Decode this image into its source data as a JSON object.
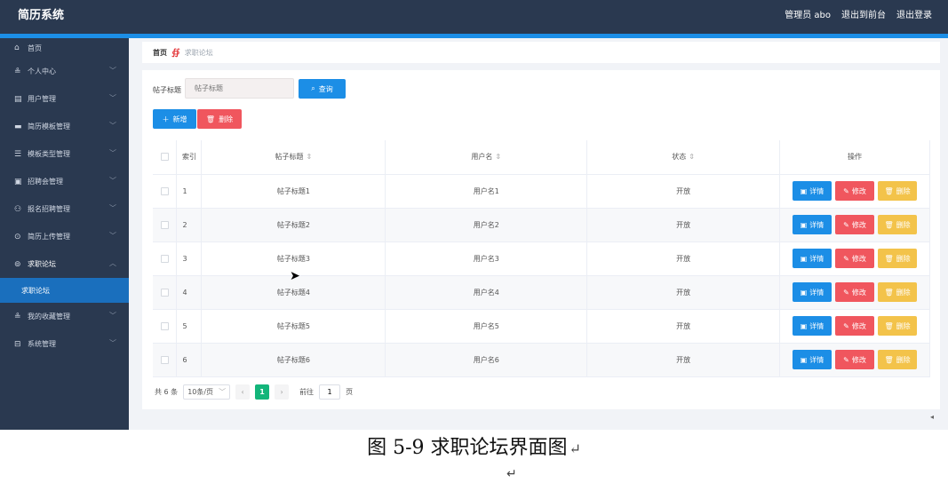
{
  "header": {
    "brand": "简历系统",
    "user": "管理员 abo",
    "to_front": "退出到前台",
    "logout": "退出登录"
  },
  "sidebar": {
    "items": [
      {
        "icon": "home-icon",
        "glyph": "⌂",
        "label": "首页"
      },
      {
        "icon": "user-icon",
        "glyph": "≗",
        "label": "个人中心"
      },
      {
        "icon": "users-icon",
        "glyph": "▤",
        "label": "用户管理"
      },
      {
        "icon": "template-icon",
        "glyph": "▬",
        "label": "简历模板管理"
      },
      {
        "icon": "category-icon",
        "glyph": "☰",
        "label": "模板类型管理"
      },
      {
        "icon": "job-fair-icon",
        "glyph": "▣",
        "label": "招聘会管理"
      },
      {
        "icon": "apply-icon",
        "glyph": "⚇",
        "label": "报名招聘管理"
      },
      {
        "icon": "upload-icon",
        "glyph": "⊙",
        "label": "简历上传管理"
      },
      {
        "icon": "forum-icon",
        "glyph": "⊚",
        "label": "求职论坛"
      },
      {
        "icon": "favorite-icon",
        "glyph": "≗",
        "label": "我的收藏管理"
      },
      {
        "icon": "system-icon",
        "glyph": "⊟",
        "label": "系统管理"
      }
    ],
    "active_sub": "求职论坛"
  },
  "breadcrumb": {
    "home": "首页",
    "separator": "∯",
    "current": "求职论坛"
  },
  "search": {
    "label": "帖子标题",
    "placeholder": "帖子标题",
    "query_button": "查询"
  },
  "toolbar": {
    "add": "新增",
    "delete": "删除"
  },
  "table": {
    "headers": {
      "index": "索引",
      "title": "帖子标题",
      "username": "用户名",
      "status": "状态",
      "actions": "操作"
    },
    "rows": [
      {
        "index": "1",
        "title": "帖子标题1",
        "username": "用户名1",
        "status": "开放"
      },
      {
        "index": "2",
        "title": "帖子标题2",
        "username": "用户名2",
        "status": "开放"
      },
      {
        "index": "3",
        "title": "帖子标题3",
        "username": "用户名3",
        "status": "开放"
      },
      {
        "index": "4",
        "title": "帖子标题4",
        "username": "用户名4",
        "status": "开放"
      },
      {
        "index": "5",
        "title": "帖子标题5",
        "username": "用户名5",
        "status": "开放"
      },
      {
        "index": "6",
        "title": "帖子标题6",
        "username": "用户名6",
        "status": "开放"
      }
    ],
    "row_actions": {
      "detail": "详情",
      "edit": "修改",
      "remove": "删除"
    }
  },
  "pagination": {
    "total": "共 6 条",
    "page_size": "10条/页",
    "current_page": "1",
    "goto_label": "前往",
    "goto_value": "1",
    "page_unit": "页"
  },
  "caption": {
    "text": "图 5-9 求职论坛界面图",
    "mark": "↵",
    "para_mark": "↵"
  },
  "colors": {
    "sidebar": "#2a3950",
    "accent": "#1c8ee6",
    "danger": "#f0565e",
    "warning": "#f3c34a",
    "success": "#13b57a"
  }
}
